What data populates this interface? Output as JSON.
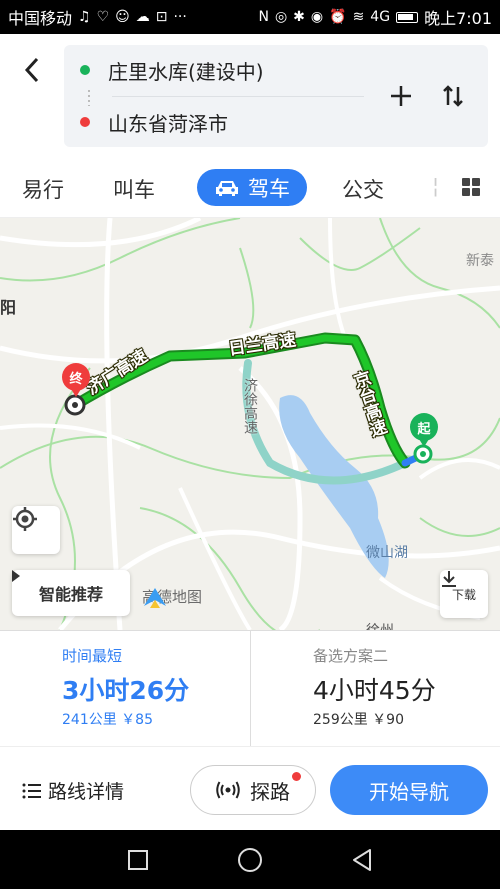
{
  "status_bar": {
    "carrier": "中国移动",
    "notif_icons": [
      "♫",
      "♡",
      "☺",
      "☁",
      "⊡",
      "···"
    ],
    "sys_icons": [
      "N",
      "◎",
      "✱",
      "◉",
      "⏰",
      "≋",
      "4G"
    ],
    "time": "晚上7:01"
  },
  "route": {
    "from": "庄里水库(建设中)",
    "to": "山东省菏泽市"
  },
  "tabs": {
    "taxi_easy": "易行",
    "call_car": "叫车",
    "drive": "驾车",
    "bus": "公交",
    "more_partial": "¦"
  },
  "map": {
    "place_labels": {
      "xintai": "新泰",
      "yang": "阳",
      "weishan_lake": "微山湖",
      "xuzhou_partial": "徐州"
    },
    "road_labels": {
      "ji_guang": "济广高速",
      "ri_lan": "日兰高速",
      "jing_tai": "京台高速",
      "ji_xu": "济徐高速"
    },
    "pin_end": "终",
    "pin_start": "起",
    "smart_recommend": "智能推荐",
    "logo_text": "高德地图",
    "download": "下载",
    "colors": {
      "route_green": "#1fc629",
      "alt_route": "#8fd3c8",
      "water": "#a8cdf2",
      "road": "#ffffff",
      "greenline": "#a9e1a3"
    }
  },
  "options": [
    {
      "title": "时间最短",
      "time": "3小时26分",
      "meta": "241公里 ￥85"
    },
    {
      "title": "备选方案二",
      "time": "4小时45分",
      "meta": "259公里 ￥90"
    }
  ],
  "actions": {
    "details": "路线详情",
    "explore": "探路",
    "start_nav": "开始导航"
  }
}
